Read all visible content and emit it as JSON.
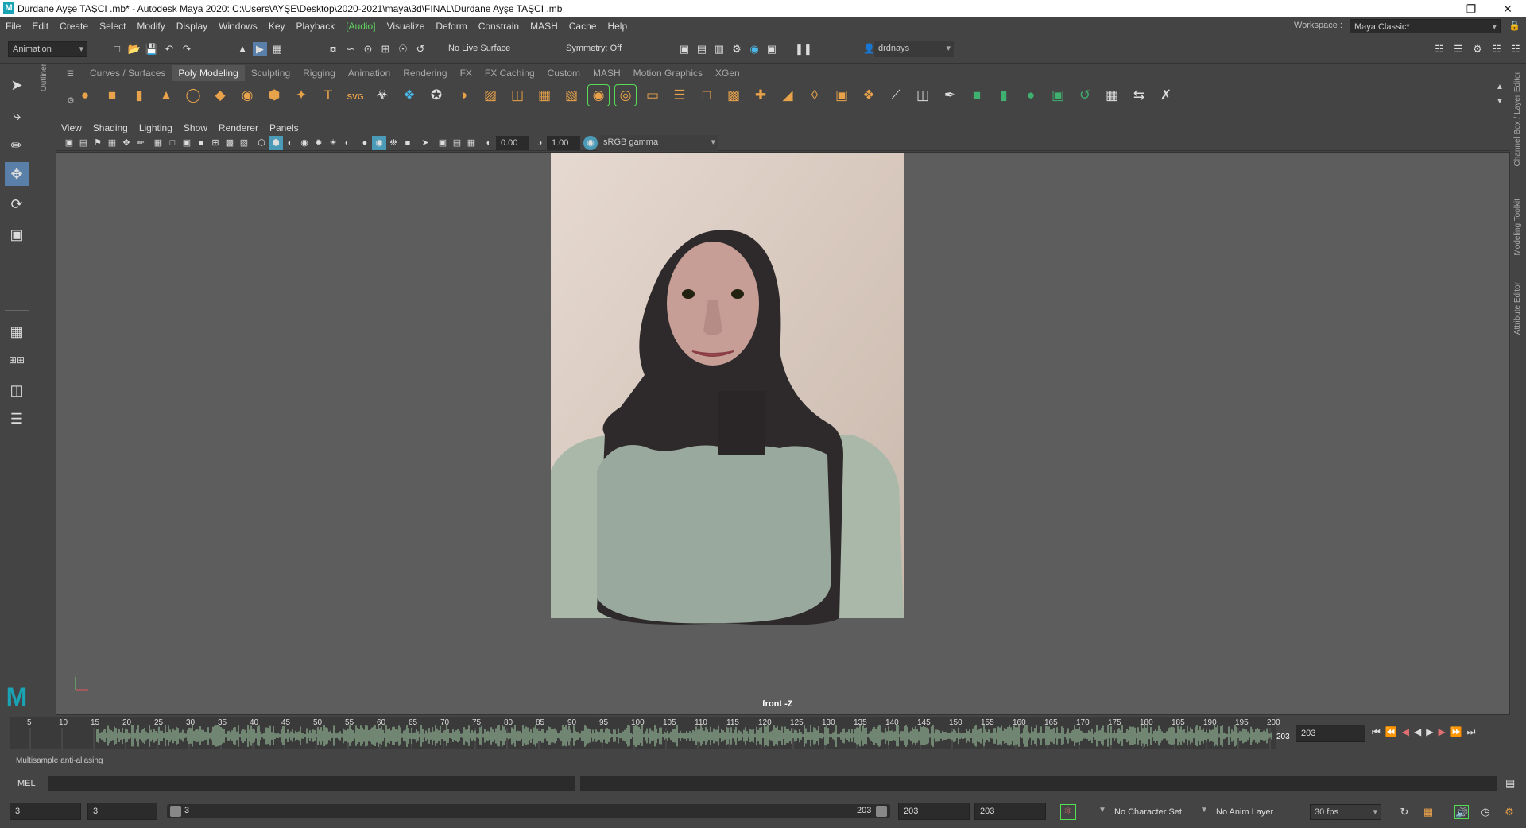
{
  "window": {
    "title": "Durdane Ayşe TAŞCI .mb* - Autodesk Maya 2020: C:\\Users\\AYŞE\\Desktop\\2020-2021\\maya\\3d\\FINAL\\Durdane Ayşe TAŞCI .mb",
    "app_logo": "M"
  },
  "menu": {
    "items": [
      "File",
      "Edit",
      "Create",
      "Select",
      "Modify",
      "Display",
      "Windows",
      "Key",
      "Playback",
      "[Audio]",
      "Visualize",
      "Deform",
      "Constrain",
      "MASH",
      "Cache",
      "Help"
    ]
  },
  "workspace": {
    "label": "Workspace :",
    "value": "Maya Classic*"
  },
  "status_line": {
    "menu_set": "Animation",
    "live_surface": "No Live Surface",
    "symmetry": "Symmetry: Off",
    "user": "drdnays"
  },
  "shelf": {
    "tabs": [
      "Curves / Surfaces",
      "Poly Modeling",
      "Sculpting",
      "Rigging",
      "Animation",
      "Rendering",
      "FX",
      "FX Caching",
      "Custom",
      "MASH",
      "Motion Graphics",
      "XGen"
    ],
    "active_tab": "Poly Modeling"
  },
  "side_labels": {
    "outliner": "Outliner",
    "channel_box": "Channel Box / Layer Editor",
    "modeling_toolkit": "Modeling Toolkit",
    "attribute_editor": "Attribute Editor"
  },
  "panel": {
    "menus": [
      "View",
      "Shading",
      "Lighting",
      "Show",
      "Renderer",
      "Panels"
    ],
    "exposure": "0.00",
    "gamma": "1.00",
    "color_space": "sRGB gamma",
    "camera_label": "front -Z"
  },
  "timeline": {
    "ticks": [
      "5",
      "10",
      "15",
      "20",
      "25",
      "30",
      "35",
      "40",
      "45",
      "50",
      "55",
      "60",
      "65",
      "70",
      "75",
      "80",
      "85",
      "90",
      "95",
      "100",
      "105",
      "110",
      "115",
      "120",
      "125",
      "130",
      "135",
      "140",
      "145",
      "150",
      "155",
      "160",
      "165",
      "170",
      "175",
      "180",
      "185",
      "190",
      "195",
      "200"
    ],
    "current_frame_marker": "203",
    "current_frame": "203"
  },
  "help_line": "Multisample anti-aliasing",
  "command_line": {
    "lang": "MEL"
  },
  "range": {
    "start_outer": "3",
    "start_inner": "3",
    "slider_start": "3",
    "slider_end": "203",
    "end_inner": "203",
    "end_outer": "203",
    "character_set": "No Character Set",
    "anim_layer": "No Anim Layer",
    "fps": "30 fps"
  }
}
